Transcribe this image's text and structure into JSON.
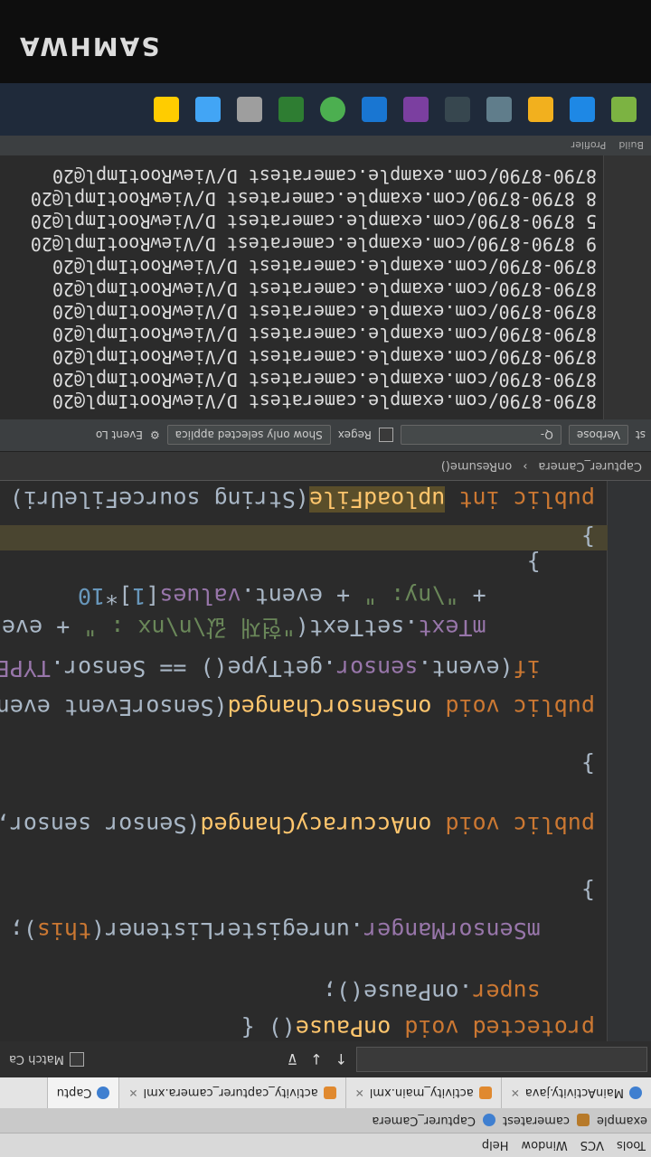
{
  "menu": [
    "Tools",
    "VCS",
    "Window",
    "Help"
  ],
  "breadcrumbs": [
    "example",
    "cameratest",
    "Capturer_Camera"
  ],
  "tabs": [
    {
      "label": "MainActivity.java",
      "active": false
    },
    {
      "label": "activity_main.xml",
      "active": false
    },
    {
      "label": "activity_capturer_camera.xml",
      "active": false
    },
    {
      "label": "Captu",
      "active": true
    }
  ],
  "find": {
    "match_case": "Match Ca"
  },
  "code": [
    "protected void onPause() {",
    "    super.onPause();",
    "    mSensorManger.unregisterListener(this);",
    "}",
    "public void onAccuracyChanged(Sensor sensor, i",
    "}",
    "public void onSensorChanged(SensorEvent event)",
    "    if(event.sensor.getType() == Sensor.TYPE_AC",
    "        mText.setText(\"현재 값 \\n\\nx : \" + eve",
    "        + \"\\ny: \" + event.values[1]*10",
    "    }",
    "}",
    "public int uploadFile(String sourceFileUri) {..."
  ],
  "editor_breadcrumb": [
    "Capturer_Camera",
    "onResume()"
  ],
  "log_toolbar": {
    "level": "Verbose",
    "search": "Q-",
    "regex": "Regex",
    "filter": "Show only selected applica",
    "event_log": "Event Lo",
    "st": "st"
  },
  "log_lines": [
    "8790-8790/com.example.cameratest D/ViewRootImpl@20",
    "8790-8790/com.example.cameratest D/ViewRootImpl@20",
    "8790-8790/com.example.cameratest D/ViewRootImpl@20",
    "8790-8790/com.example.cameratest D/ViewRootImpl@20",
    "8790-8790/com.example.cameratest D/ViewRootImpl@20",
    "8790-8790/com.example.cameratest D/ViewRootImpl@20",
    "8790-8790/com.example.cameratest D/ViewRootImpl@20",
    "9 8790-8790/com.example.cameratest D/ViewRootImpl@20",
    "5 8790-8790/com.example.cameratest D/ViewRootImpl@20",
    "8 8790-8790/com.example.cameratest D/ViewRootImpl@20",
    "8790-8790/com.example.cameratest D/ViewRootImpl@20"
  ],
  "statusbar": [
    "Build",
    "Profiler"
  ],
  "brand": "SAMHWA"
}
